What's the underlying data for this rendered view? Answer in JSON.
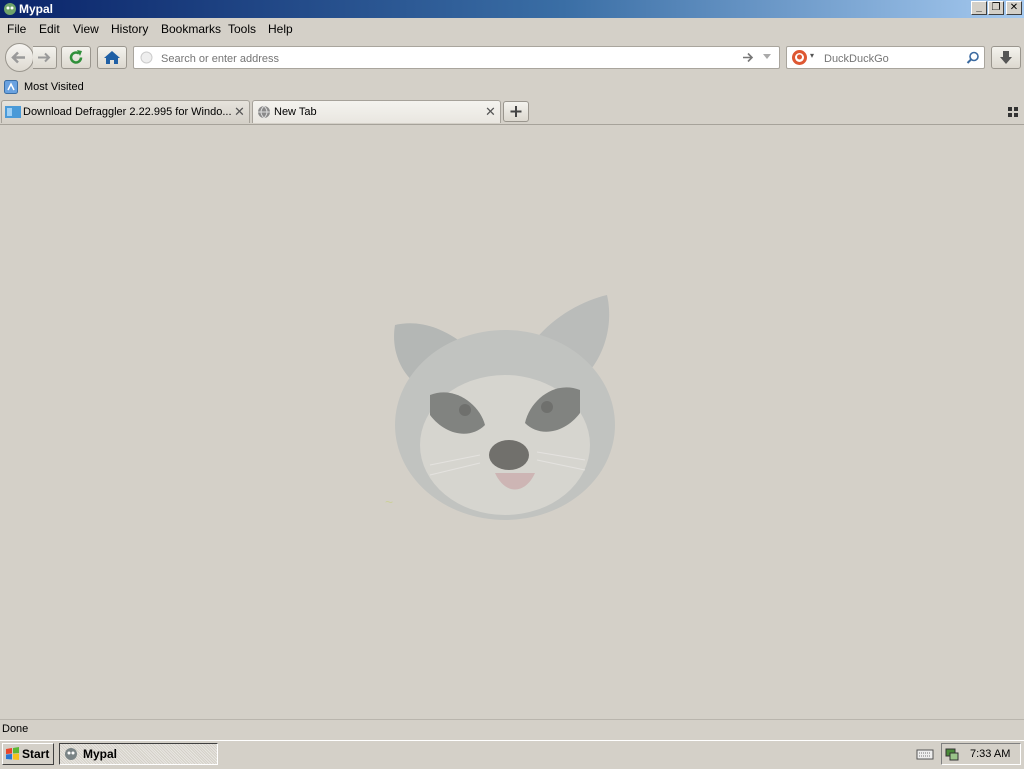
{
  "window": {
    "title": "Mypal"
  },
  "menu": [
    "File",
    "Edit",
    "View",
    "History",
    "Bookmarks",
    "Tools",
    "Help"
  ],
  "address_bar": {
    "placeholder": "Search or enter address"
  },
  "search_bar": {
    "engine": "DuckDuckGo",
    "placeholder": "DuckDuckGo"
  },
  "bookmarks": {
    "most_visited": "Most Visited"
  },
  "tabs": [
    {
      "label": "Download Defraggler 2.22.995 for Windo...",
      "active": false
    },
    {
      "label": "New Tab",
      "active": true
    }
  ],
  "status": {
    "text": "Done"
  },
  "taskbar": {
    "start": "Start",
    "task": "Mypal",
    "clock": "7:33 AM"
  },
  "colors": {
    "titlebar_start": "#0a246a",
    "titlebar_end": "#a6caf0",
    "background": "#d4d0c8",
    "home": "#1f5fa5",
    "reload": "#2f8f3a"
  },
  "icons": [
    "app-icon",
    "back-arrow-icon",
    "forward-arrow-icon",
    "reload-icon",
    "home-icon",
    "page-icon",
    "go-arrow-icon",
    "dropdown-icon",
    "duckduckgo-icon",
    "search-icon",
    "download-icon",
    "most-visited-icon",
    "tab-favicon",
    "globe-icon",
    "close-icon",
    "plus-icon",
    "grid-icon",
    "raccoon-mascot",
    "windows-flag-icon",
    "keyboard-icon",
    "network-icon"
  ]
}
